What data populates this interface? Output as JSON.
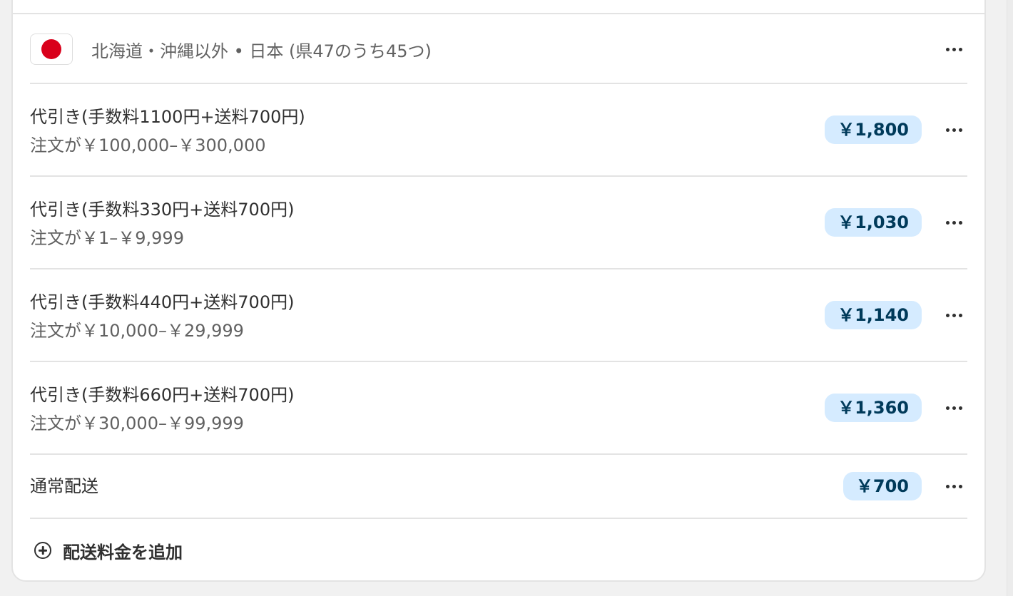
{
  "zone": {
    "title": "北海道・沖縄以外 • 日本 (県47のうち45つ)",
    "flag_icon": "japan-flag-icon"
  },
  "rates": [
    {
      "name": "代引き(手数料1100円+送料700円)",
      "condition": "注文が￥100,000–￥300,000",
      "price": "￥1,800"
    },
    {
      "name": "代引き(手数料330円+送料700円)",
      "condition": "注文が￥1–￥9,999",
      "price": "￥1,030"
    },
    {
      "name": "代引き(手数料440円+送料700円)",
      "condition": "注文が￥10,000–￥29,999",
      "price": "￥1,140"
    },
    {
      "name": "代引き(手数料660円+送料700円)",
      "condition": "注文が￥30,000–￥99,999",
      "price": "￥1,360"
    },
    {
      "name": "通常配送",
      "condition": "",
      "price": "￥700"
    }
  ],
  "add_rate": {
    "label": "配送料金を追加",
    "icon": "plus-circle-icon"
  },
  "colors": {
    "badge_background": "#d5ebff",
    "badge_text": "#003a5a",
    "flag_red": "#d9001b",
    "divider": "#e3e3e3"
  }
}
